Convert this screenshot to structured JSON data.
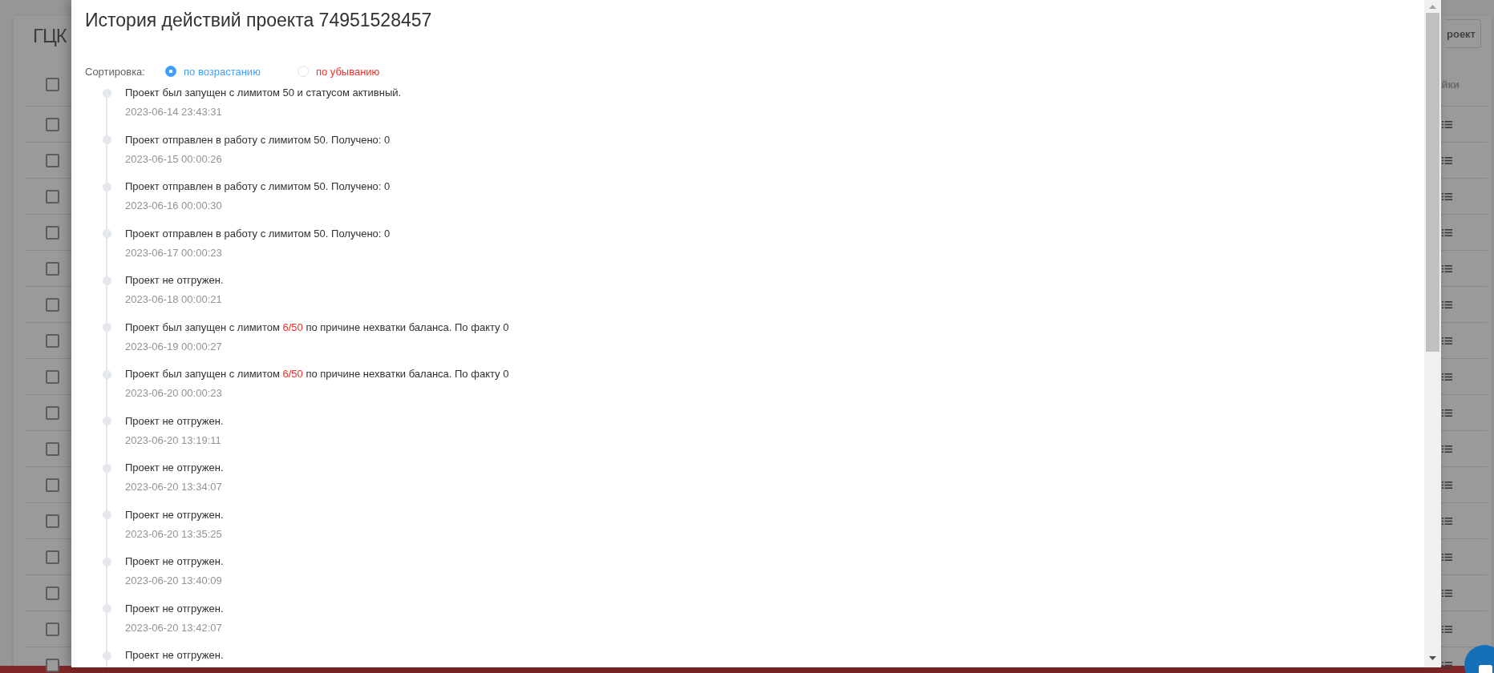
{
  "background_page": {
    "title": "ГЦК",
    "top_button": "роект",
    "table": {
      "header": {
        "checked": false,
        "column_label": "йки"
      },
      "rows": [
        {
          "checked": false
        },
        {
          "checked": false
        },
        {
          "checked": false
        },
        {
          "checked": false
        },
        {
          "checked": false
        },
        {
          "checked": false
        },
        {
          "checked": false
        },
        {
          "checked": false
        },
        {
          "checked": false
        },
        {
          "checked": false
        },
        {
          "checked": false
        },
        {
          "checked": false
        },
        {
          "checked": false
        },
        {
          "checked": false
        },
        {
          "checked": false
        },
        {
          "checked": false
        }
      ]
    }
  },
  "history_dialog": {
    "title": "История действий проекта 74951528457",
    "sort": {
      "label": "Сортировка:",
      "options": [
        {
          "label": "по возрастанию",
          "selected": true
        },
        {
          "label": "по убыванию",
          "selected": false
        }
      ]
    },
    "history": [
      {
        "segments": [
          {
            "text": "Проект был запущен с лимитом 50 и статусом активный.",
            "highlight": false
          }
        ],
        "time": "2023-06-14 23:43:31"
      },
      {
        "segments": [
          {
            "text": "Проект отправлен в работу с лимитом 50. Получено: 0",
            "highlight": false
          }
        ],
        "time": "2023-06-15 00:00:26"
      },
      {
        "segments": [
          {
            "text": "Проект отправлен в работу с лимитом 50. Получено: 0",
            "highlight": false
          }
        ],
        "time": "2023-06-16 00:00:30"
      },
      {
        "segments": [
          {
            "text": "Проект отправлен в работу с лимитом 50. Получено: 0",
            "highlight": false
          }
        ],
        "time": "2023-06-17 00:00:23"
      },
      {
        "segments": [
          {
            "text": "Проект не отгружен.",
            "highlight": false
          }
        ],
        "time": "2023-06-18 00:00:21"
      },
      {
        "segments": [
          {
            "text": "Проект был запущен с лимитом ",
            "highlight": false
          },
          {
            "text": "6/50",
            "highlight": true
          },
          {
            "text": " по причине нехватки баланса. По факту 0",
            "highlight": false
          }
        ],
        "time": "2023-06-19 00:00:27"
      },
      {
        "segments": [
          {
            "text": "Проект был запущен с лимитом ",
            "highlight": false
          },
          {
            "text": "6/50",
            "highlight": true
          },
          {
            "text": " по причине нехватки баланса. По факту 0",
            "highlight": false
          }
        ],
        "time": "2023-06-20 00:00:23"
      },
      {
        "segments": [
          {
            "text": "Проект не отгружен.",
            "highlight": false
          }
        ],
        "time": "2023-06-20 13:19:11"
      },
      {
        "segments": [
          {
            "text": "Проект не отгружен.",
            "highlight": false
          }
        ],
        "time": "2023-06-20 13:34:07"
      },
      {
        "segments": [
          {
            "text": "Проект не отгружен.",
            "highlight": false
          }
        ],
        "time": "2023-06-20 13:35:25"
      },
      {
        "segments": [
          {
            "text": "Проект не отгружен.",
            "highlight": false
          }
        ],
        "time": "2023-06-20 13:40:09"
      },
      {
        "segments": [
          {
            "text": "Проект не отгружен.",
            "highlight": false
          }
        ],
        "time": "2023-06-20 13:42:07"
      },
      {
        "segments": [
          {
            "text": "Проект не отгружен.",
            "highlight": false
          }
        ]
      }
    ]
  }
}
